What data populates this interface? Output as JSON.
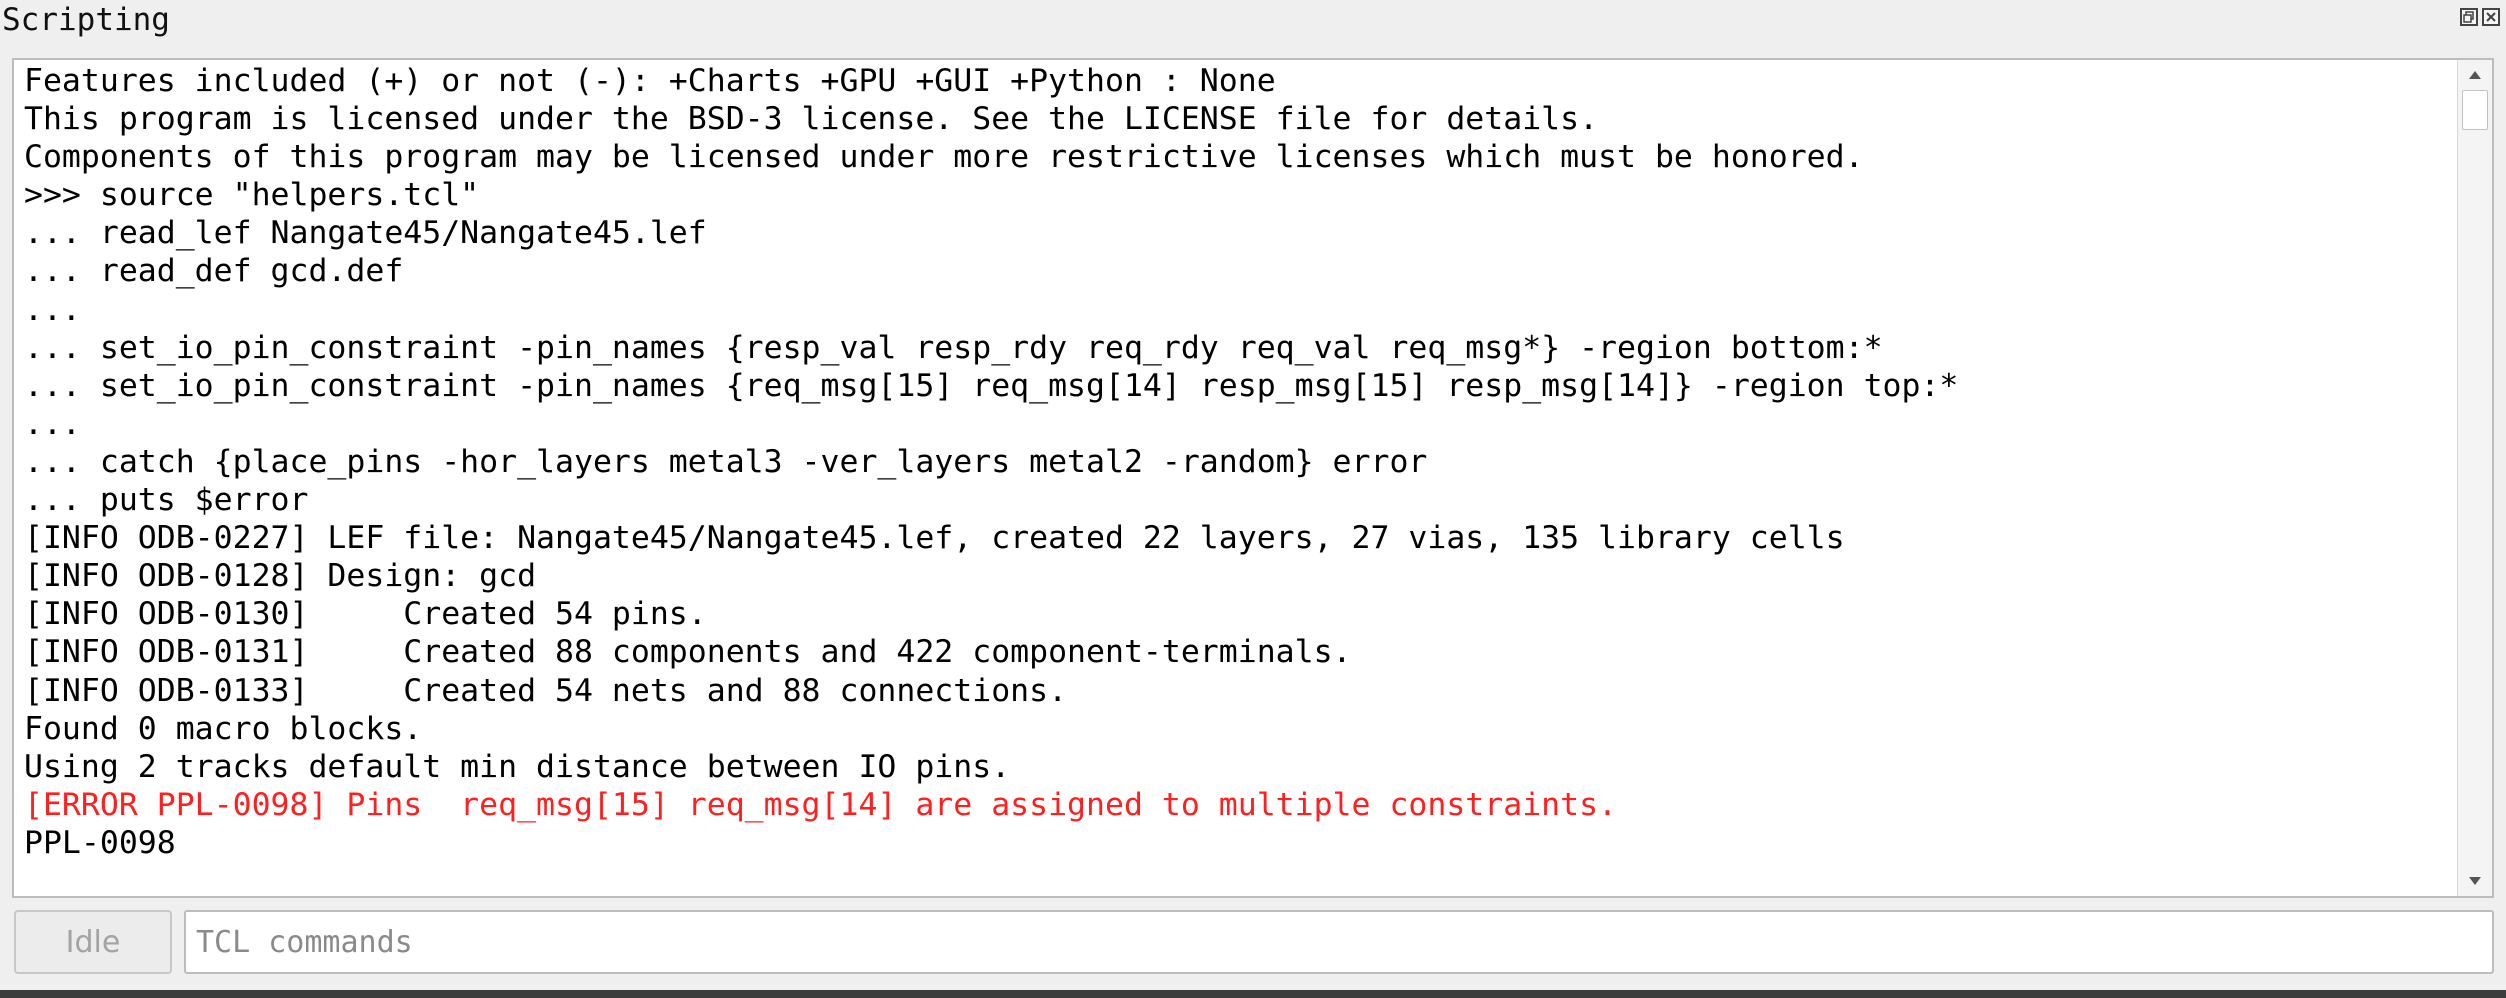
{
  "window": {
    "title": "Scripting"
  },
  "console": {
    "lines": [
      {
        "text": "Features included (+) or not (-): +Charts +GPU +GUI +Python : None",
        "type": "normal"
      },
      {
        "text": "This program is licensed under the BSD-3 license. See the LICENSE file for details.",
        "type": "normal"
      },
      {
        "text": "Components of this program may be licensed under more restrictive licenses which must be honored.",
        "type": "normal"
      },
      {
        "text": ">>> source \"helpers.tcl\"",
        "type": "normal"
      },
      {
        "text": "... read_lef Nangate45/Nangate45.lef",
        "type": "normal"
      },
      {
        "text": "... read_def gcd.def",
        "type": "normal"
      },
      {
        "text": "...",
        "type": "normal"
      },
      {
        "text": "... set_io_pin_constraint -pin_names {resp_val resp_rdy req_rdy req_val req_msg*} -region bottom:*",
        "type": "normal"
      },
      {
        "text": "... set_io_pin_constraint -pin_names {req_msg[15] req_msg[14] resp_msg[15] resp_msg[14]} -region top:*",
        "type": "normal"
      },
      {
        "text": "...",
        "type": "normal"
      },
      {
        "text": "... catch {place_pins -hor_layers metal3 -ver_layers metal2 -random} error",
        "type": "normal"
      },
      {
        "text": "... puts $error",
        "type": "normal"
      },
      {
        "text": "[INFO ODB-0227] LEF file: Nangate45/Nangate45.lef, created 22 layers, 27 vias, 135 library cells",
        "type": "normal"
      },
      {
        "text": "[INFO ODB-0128] Design: gcd",
        "type": "normal"
      },
      {
        "text": "[INFO ODB-0130]     Created 54 pins.",
        "type": "normal"
      },
      {
        "text": "[INFO ODB-0131]     Created 88 components and 422 component-terminals.",
        "type": "normal"
      },
      {
        "text": "[INFO ODB-0133]     Created 54 nets and 88 connections.",
        "type": "normal"
      },
      {
        "text": "Found 0 macro blocks.",
        "type": "normal"
      },
      {
        "text": "Using 2 tracks default min distance between IO pins.",
        "type": "normal"
      },
      {
        "text": "[ERROR PPL-0098] Pins  req_msg[15] req_msg[14] are assigned to multiple constraints.",
        "type": "error"
      },
      {
        "text": "PPL-0098",
        "type": "normal"
      }
    ]
  },
  "status": {
    "label": "Idle"
  },
  "command": {
    "placeholder": "TCL commands",
    "value": ""
  },
  "colors": {
    "error": "#ff1f1f",
    "text": "#000000",
    "background": "#efefef"
  },
  "icons": {
    "title_buttons": [
      "float-icon",
      "close-icon"
    ],
    "scroll": [
      "arrow-up-icon",
      "arrow-down-icon"
    ]
  }
}
